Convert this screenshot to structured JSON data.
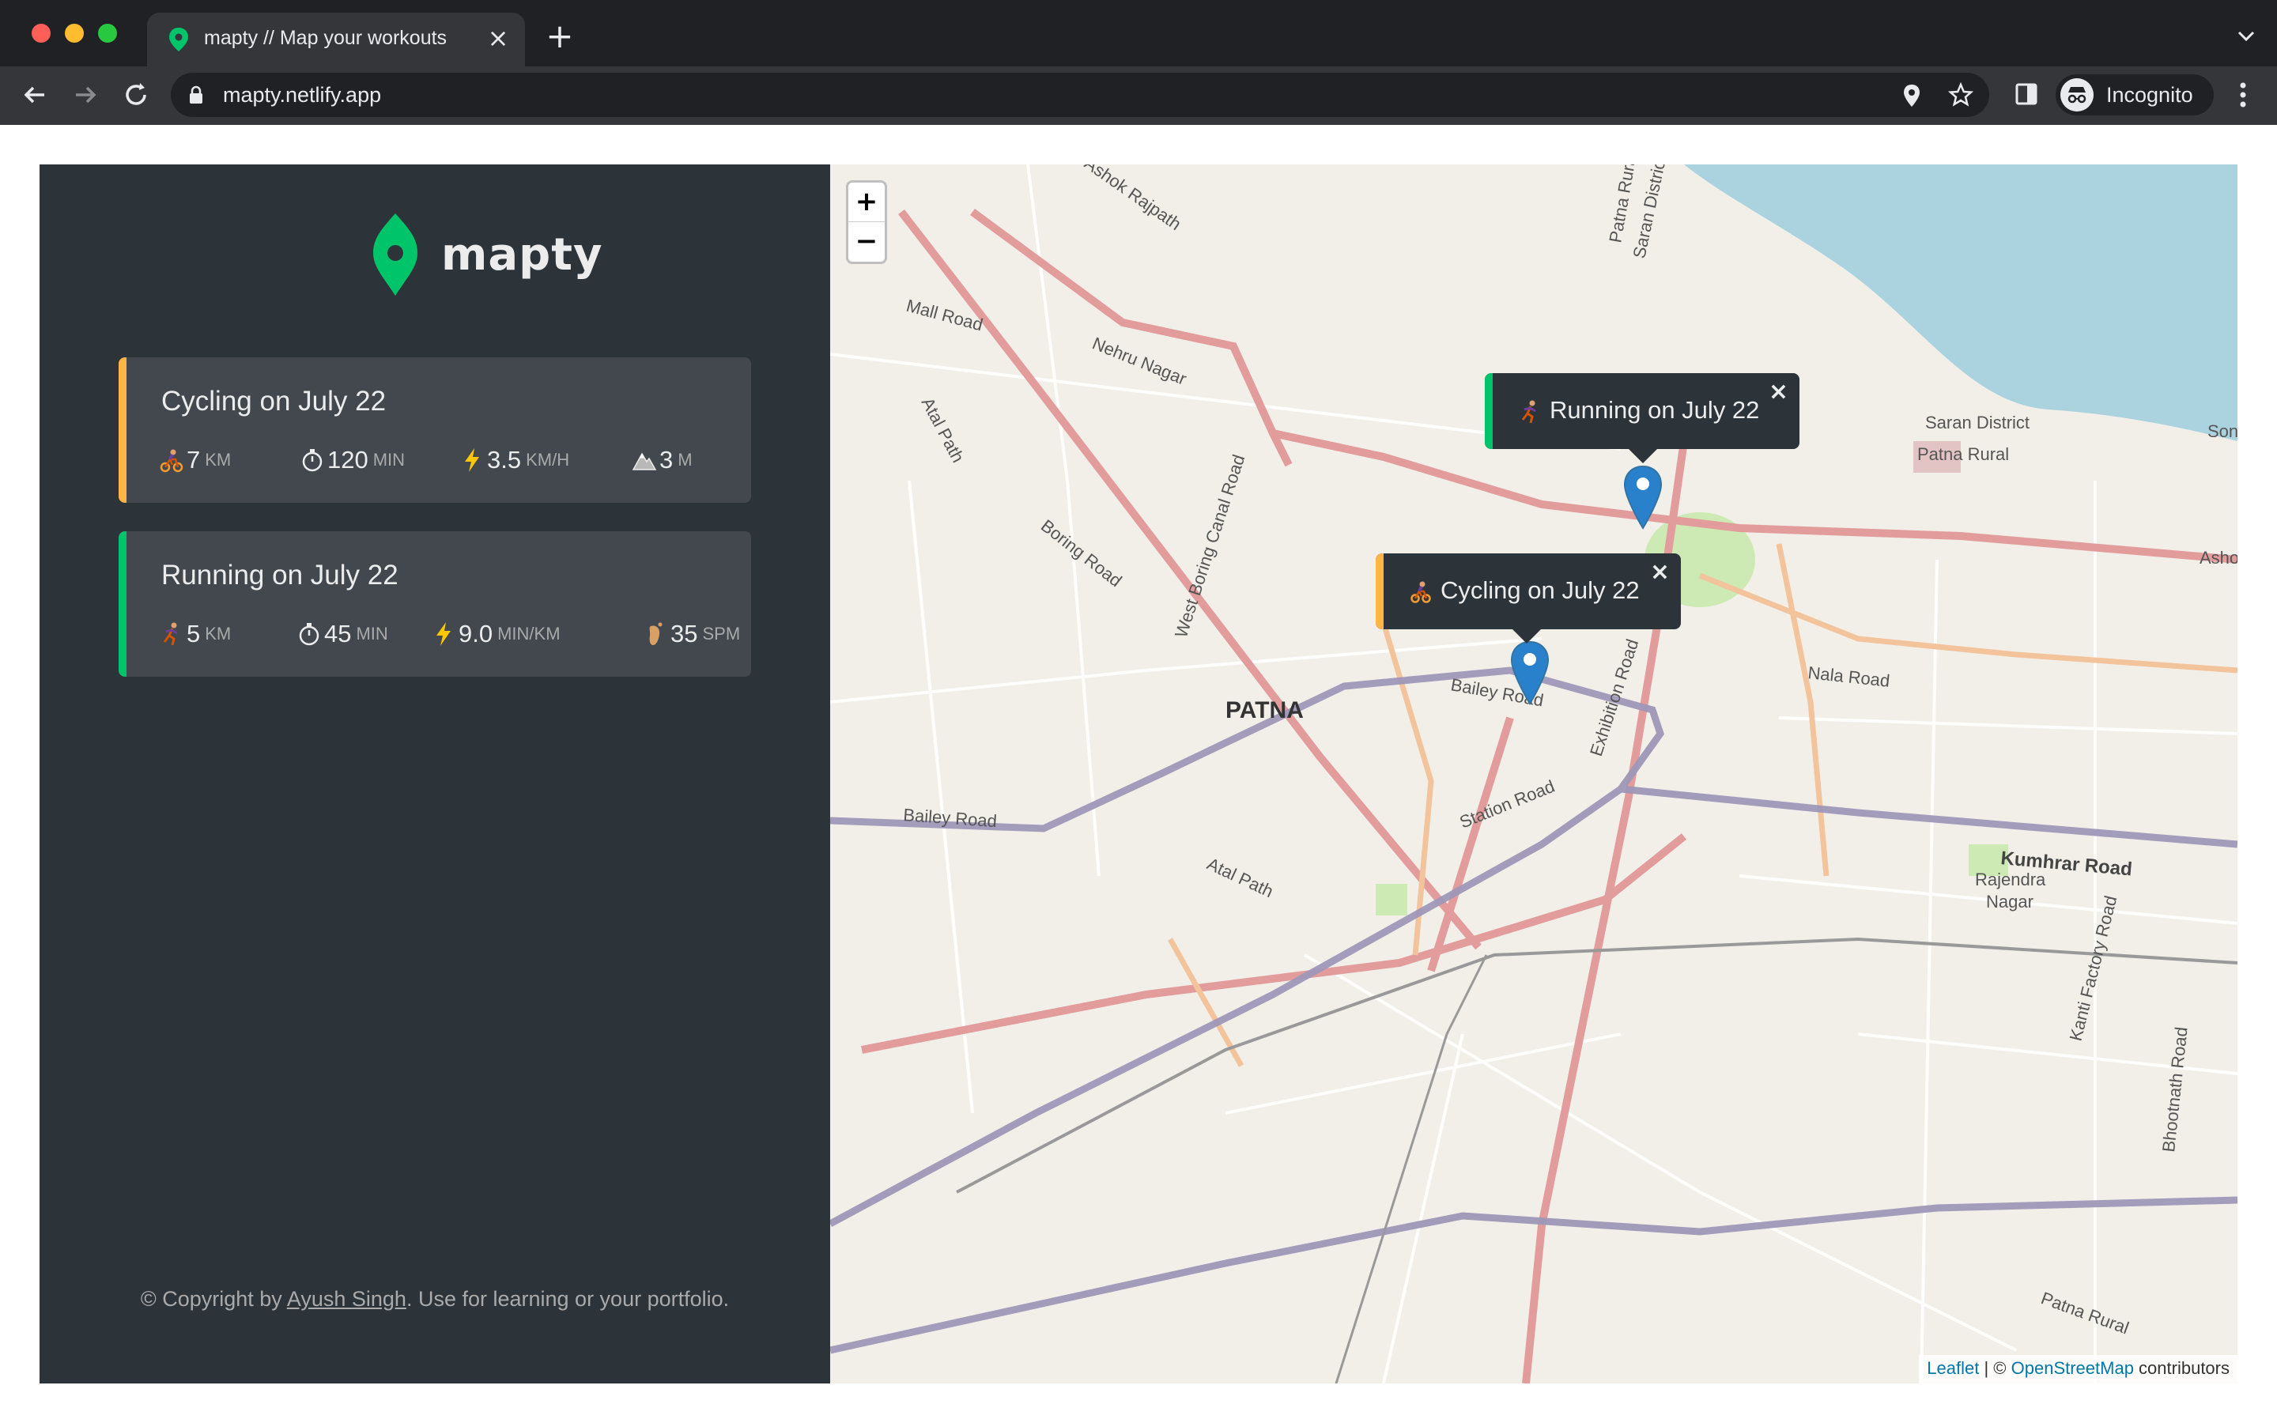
{
  "browser": {
    "tab_title": "mapty // Map your workouts",
    "url": "mapty.netlify.app",
    "profile_label": "Incognito"
  },
  "app": {
    "logo_text": "mapty",
    "copyright_prefix": "© Copyright by ",
    "copyright_author": "Ayush Singh",
    "copyright_suffix": ". Use for learning or your portfolio.",
    "accent_running": "#00c46a",
    "accent_cycling": "#ffb545"
  },
  "workouts": [
    {
      "type": "cycling",
      "title": "Cycling on July 22",
      "details": [
        {
          "icon": "cyclist-icon",
          "value": "7",
          "unit": "km"
        },
        {
          "icon": "stopwatch-icon",
          "value": "120",
          "unit": "min"
        },
        {
          "icon": "lightning-icon",
          "value": "3.5",
          "unit": "km/h"
        },
        {
          "icon": "mountain-icon",
          "value": "3",
          "unit": "m"
        }
      ]
    },
    {
      "type": "running",
      "title": "Running on July 22",
      "details": [
        {
          "icon": "runner-icon",
          "value": "5",
          "unit": "km"
        },
        {
          "icon": "stopwatch-icon",
          "value": "45",
          "unit": "min"
        },
        {
          "icon": "lightning-icon",
          "value": "9.0",
          "unit": "min/km"
        },
        {
          "icon": "footprint-icon",
          "value": "35",
          "unit": "spm"
        }
      ]
    }
  ],
  "map": {
    "zoom_in": "+",
    "zoom_out": "−",
    "popups": [
      {
        "type": "running",
        "text": "Running on July 22",
        "close": "×"
      },
      {
        "type": "cycling",
        "text": "Cycling on July 22",
        "close": "×"
      }
    ],
    "labels": {
      "city": "PATNA",
      "mall_road": "Mall Road",
      "nehru_nagar": "Nehru Nagar",
      "atal_path": "Atal Path",
      "boring_road": "Boring Road",
      "west_boring_canal_road": "West Boring Canal Road",
      "bailey_road_center": "Bailey Road",
      "bailey_road_west": "Bailey Road",
      "exhibition_road": "Exhibition Road",
      "station_road": "Station Road",
      "nala_road": "Nala Road",
      "kumhrar_road": "Kumhrar Road",
      "rajendra_nagar_1": "Rajendra",
      "rajendra_nagar_2": "Nagar",
      "kanti_factory_road": "Kanti Factory Road",
      "bhootnath_road": "Bhootnath Road",
      "saran_district": "Saran District",
      "patna_rural_east": "Patna Rural",
      "patna_rural_bottom": "Patna Rural",
      "patna_rural_top": "Patna Rural",
      "saran_district_top": "Saran District",
      "ashok_rajpath": "Ashok Rajpath",
      "atal_path_lower": "Atal Path",
      "ashok_edge": "Asho",
      "son_edge": "Son"
    },
    "attribution": {
      "leaflet": "Leaflet",
      "separator": " | © ",
      "osm": "OpenStreetMap",
      "contributors": " contributors"
    }
  }
}
